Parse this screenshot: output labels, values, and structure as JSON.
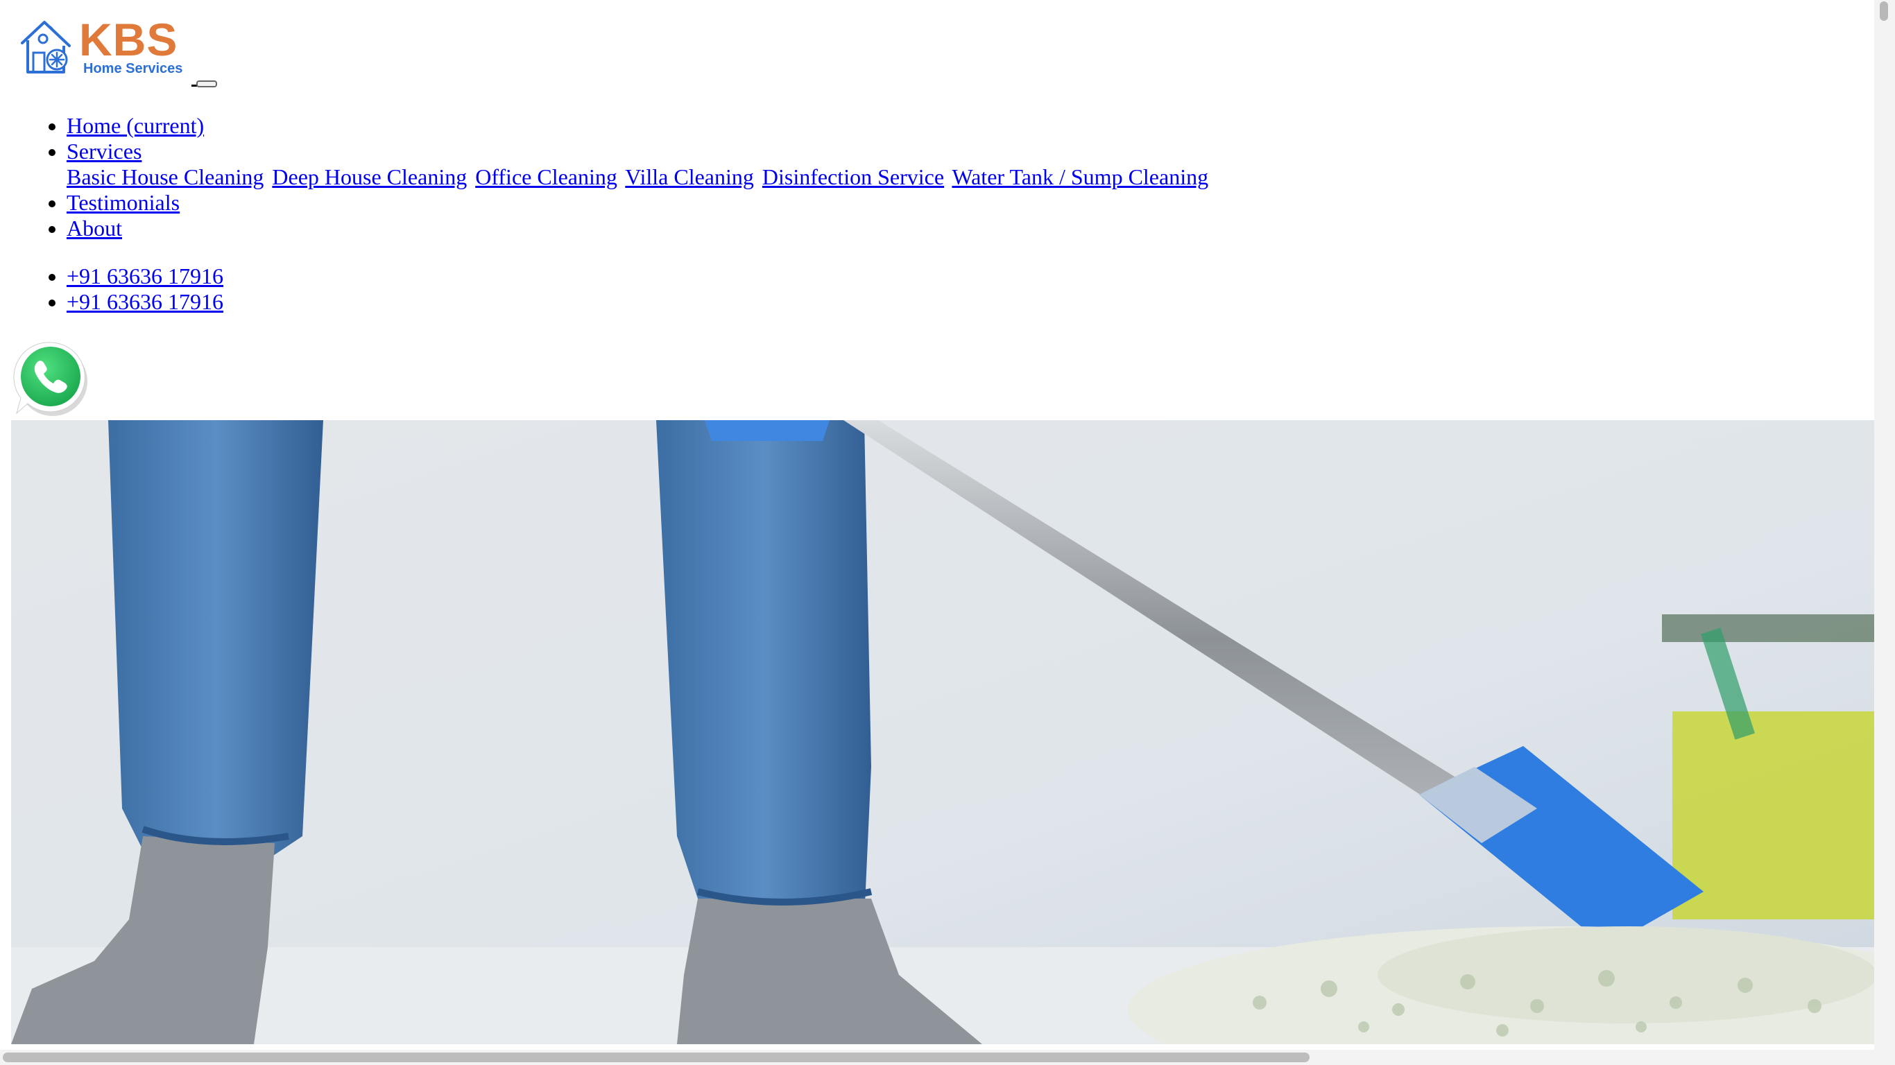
{
  "logo": {
    "brand": "KBS",
    "tagline": "Home Services",
    "icon": "house-snowflake-icon"
  },
  "nav": {
    "items": [
      {
        "label": "Home (current)"
      },
      {
        "label": "Services"
      },
      {
        "label": "Testimonials"
      },
      {
        "label": "About"
      }
    ],
    "services_submenu": [
      "Basic House Cleaning",
      "Deep House Cleaning",
      "Office Cleaning",
      "Villa Cleaning",
      "Disinfection Service",
      "Water Tank / Sump Cleaning"
    ]
  },
  "contact": {
    "phones": [
      "+91 63636 17916",
      "+91 63636 17916"
    ]
  },
  "icons": {
    "whatsapp": "whatsapp-icon"
  },
  "hero": {
    "image": "person-mopping-floor-photo"
  },
  "colors": {
    "brand_orange": "#e07a3a",
    "brand_blue": "#2c6fd6",
    "link": "#0000ee",
    "whatsapp_green": "#25d366"
  }
}
